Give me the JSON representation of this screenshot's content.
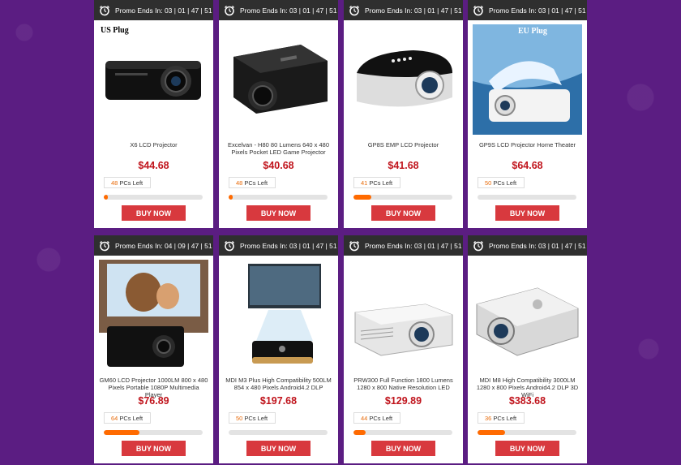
{
  "products": [
    {
      "promo_label": "Promo Ends In: 03 | 01 | 47 | 51",
      "name": "X6 LCD Projector",
      "price": "$44.68",
      "stock_count": "48",
      "stock_suffix": "PCs Left",
      "progress": 0.04,
      "buy_label": "BUY NOW",
      "plug_label": "US  Plug"
    },
    {
      "promo_label": "Promo Ends In: 03 | 01 | 47 | 51",
      "name": "Excelvan - H80 80 Lumens 640 x 480 Pixels Pocket LED Game Projector",
      "price": "$40.68",
      "stock_count": "48",
      "stock_suffix": "PCs Left",
      "progress": 0.04,
      "buy_label": "BUY NOW",
      "plug_label": ""
    },
    {
      "promo_label": "Promo Ends In: 03 | 01 | 47 | 51",
      "name": "GP8S EMP LCD Projector",
      "price": "$41.68",
      "stock_count": "41",
      "stock_suffix": "PCs Left",
      "progress": 0.18,
      "buy_label": "BUY NOW",
      "plug_label": ""
    },
    {
      "promo_label": "Promo Ends In: 03 | 01 | 47 | 51",
      "name": "GP9S LCD Projector Home Theater",
      "price": "$64.68",
      "stock_count": "50",
      "stock_suffix": "PCs Left",
      "progress": 0.0,
      "buy_label": "BUY NOW",
      "plug_label": "EU Plug"
    },
    {
      "promo_label": "Promo Ends In: 04 | 09 | 47 | 51",
      "name": "GM60 LCD Projector 1000LM 800 x 480 Pixels Portable 1080P Multimedia Player",
      "price": "$76.89",
      "stock_count": "64",
      "stock_suffix": "PCs Left",
      "progress": 0.36,
      "buy_label": "BUY NOW",
      "plug_label": ""
    },
    {
      "promo_label": "Promo Ends In: 03 | 01 | 47 | 51",
      "name": "MDI M3 Plus High Compatibility 500LM 854 x 480 Pixels Android4.2 DLP",
      "price": "$197.68",
      "stock_count": "50",
      "stock_suffix": "PCs Left",
      "progress": 0.0,
      "buy_label": "BUY NOW",
      "plug_label": ""
    },
    {
      "promo_label": "Promo Ends In: 03 | 01 | 47 | 51",
      "name": "PRW300 Full Function 1800 Lumens 1280 x 800 Native Resolution LED",
      "price": "$129.89",
      "stock_count": "44",
      "stock_suffix": "PCs Left",
      "progress": 0.12,
      "buy_label": "BUY NOW",
      "plug_label": ""
    },
    {
      "promo_label": "Promo Ends In: 03 | 01 | 47 | 51",
      "name": "MDI M8 High Compatibility 3000LM 1280 x 800 Pixels Android4.2 DLP 3D WiFi",
      "price": "$383.68",
      "stock_count": "36",
      "stock_suffix": "PCs Left",
      "progress": 0.28,
      "buy_label": "BUY NOW",
      "plug_label": ""
    }
  ],
  "colors": {
    "accent": "#d8393e",
    "price": "#c0141c",
    "progress": "#ff6a00",
    "background": "#5b1d82"
  }
}
